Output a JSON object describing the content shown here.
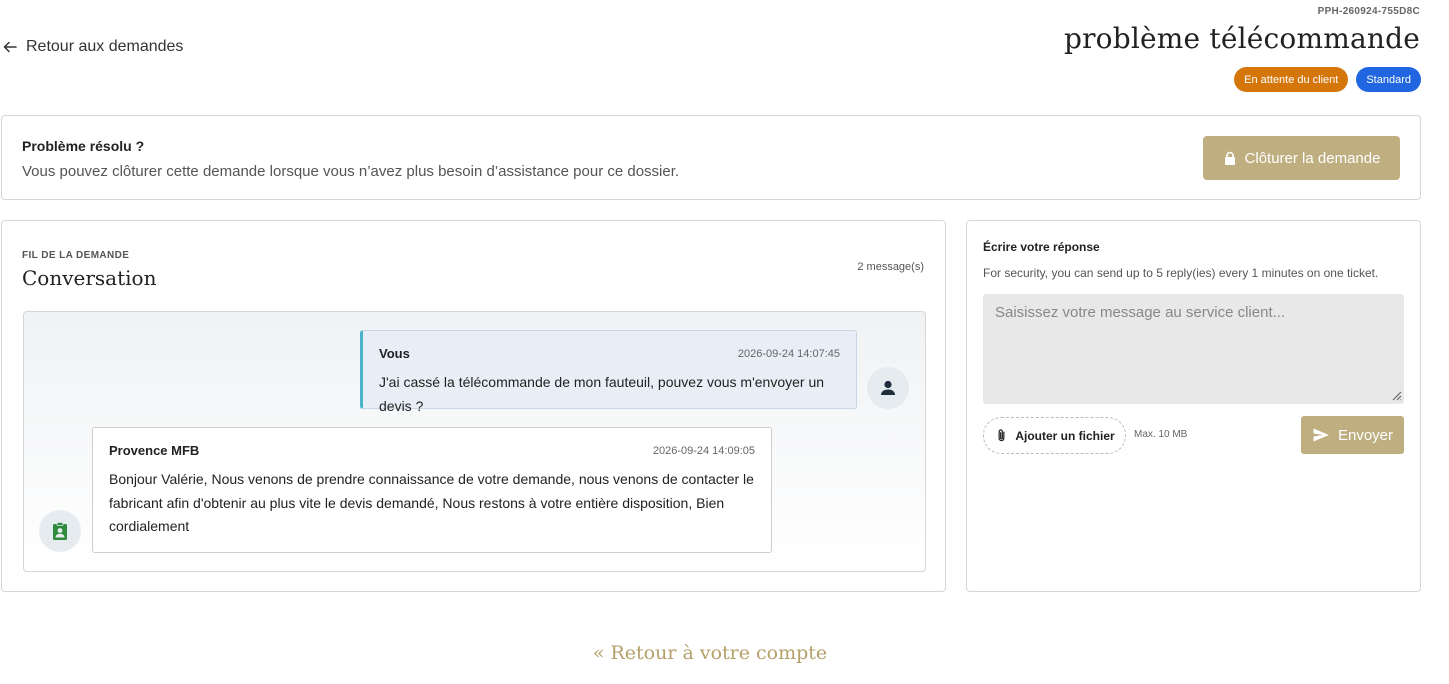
{
  "header": {
    "back_label": "Retour aux demandes",
    "ticket_ref": "PPH-260924-755D8C",
    "title": "problème télécommande",
    "status_badge": "En attente du client",
    "priority_badge": "Standard"
  },
  "resolve": {
    "title": "Problème résolu ?",
    "description": "Vous pouvez clôturer cette demande lorsque vous n’avez plus besoin d’assistance pour ce dossier.",
    "close_label": "Clôturer la demande"
  },
  "conversation": {
    "kicker": "FIL DE LA DEMANDE",
    "title": "Conversation",
    "count": "2 message(s)",
    "messages": [
      {
        "author": "Vous",
        "date": "2026-09-24 14:07:45",
        "body": "J'ai cassé la télécommande de mon fauteuil, pouvez vous m'envoyer un devis ?"
      },
      {
        "author": "Provence MFB",
        "date": "2026-09-24 14:09:05",
        "body": "Bonjour Valérie, Nous venons de prendre connaissance de votre demande, nous venons de contacter le fabricant afin d'obtenir au plus vite le devis demandé, Nous restons à votre entière disposition, Bien cordialement"
      }
    ]
  },
  "reply": {
    "title": "Écrire votre réponse",
    "note": "For security, you can send up to 5 reply(ies) every 1 minutes on one ticket.",
    "placeholder": "Saisissez votre message au service client...",
    "value": "",
    "attach_label": "Ajouter un fichier",
    "attach_max": "Max. 10 MB",
    "send_label": "Envoyer"
  },
  "footer": {
    "back_account_label": "« Retour à votre compte"
  },
  "colors": {
    "accent_gold": "#bfae80",
    "status_orange": "#d4760a",
    "priority_blue": "#2166e0",
    "my_message_border": "#4ab3c9",
    "agent_icon_green": "#2e8b3e"
  },
  "icons": {
    "back": "arrow-left-icon",
    "close": "lock-icon",
    "my_avatar": "person-icon",
    "agent_avatar": "clipboard-user-icon",
    "attach": "paperclip-icon",
    "send": "send-icon"
  }
}
